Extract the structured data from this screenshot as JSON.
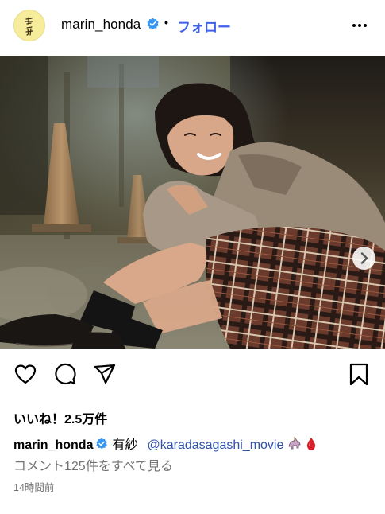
{
  "post": {
    "username": "marin_honda",
    "separator": "•",
    "follow_label": "フォロー",
    "avatar_text": "真凜",
    "icons": {
      "verified": "verified-badge-icon",
      "more": "more-options-icon",
      "next": "chevron-right-icon",
      "like": "heart-icon",
      "comment": "comment-icon",
      "share": "send-icon",
      "save": "bookmark-icon"
    },
    "carousel": {
      "slides": 4,
      "active_index": 0
    },
    "likes_label": "いいね！2.5万件",
    "caption": {
      "username": "marin_honda",
      "text": "有紗",
      "mention": "@karadasagashi_movie",
      "emojis": [
        "carousel-horse-emoji",
        "blood-drop-emoji"
      ]
    },
    "comments_link": "コメント125件をすべて見る",
    "timestamp": "14時間前"
  },
  "colors": {
    "verified": "#3897f0",
    "follow": "#3f61ea",
    "mention": "#2f4fa8",
    "muted": "#737373"
  }
}
